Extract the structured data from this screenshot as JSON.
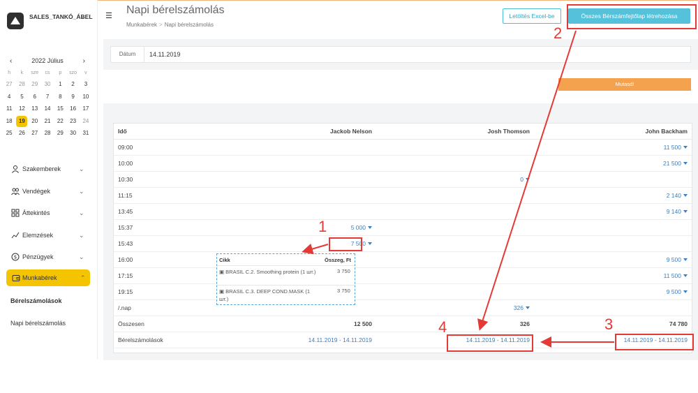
{
  "brand": {
    "name": "SALES_TANKÓ_ÁBEL"
  },
  "calendar": {
    "title": "2022 Július",
    "weekdays": [
      "h",
      "k",
      "sze",
      "cs",
      "p",
      "szo",
      "v"
    ],
    "weeks": [
      [
        "27",
        "28",
        "29",
        "30",
        "1",
        "2",
        "3"
      ],
      [
        "4",
        "5",
        "6",
        "7",
        "8",
        "9",
        "10"
      ],
      [
        "11",
        "12",
        "13",
        "14",
        "15",
        "16",
        "17"
      ],
      [
        "18",
        "19",
        "20",
        "21",
        "22",
        "23",
        "24"
      ],
      [
        "25",
        "26",
        "27",
        "28",
        "29",
        "30",
        "31"
      ]
    ],
    "today": "19"
  },
  "sidebar": {
    "items": [
      {
        "label": "Szakemberek",
        "icon": "person-icon"
      },
      {
        "label": "Vendégek",
        "icon": "users-icon"
      },
      {
        "label": "Áttekintés",
        "icon": "grid-icon"
      },
      {
        "label": "Elemzések",
        "icon": "chart-icon"
      },
      {
        "label": "Pénzügyek",
        "icon": "dollar-icon"
      }
    ],
    "active": {
      "label": "Munkabérek",
      "icon": "wallet-icon"
    },
    "subitems": [
      "Bérelszámolások",
      "Napi bérelszámolás"
    ]
  },
  "header": {
    "title": "Napi bérelszámolás",
    "breadcrumb": [
      "Munkabérek",
      "Napi bérelszámolás"
    ],
    "excel_label": "Letöltés Excel-be",
    "create_label": "Összes Bérszámfejtőlap létrehozása"
  },
  "filter": {
    "date_label": "Dátum",
    "date_value": "14.11.2019",
    "show_label": "Mutasd!"
  },
  "table": {
    "time_header": "Idő",
    "employees": [
      "Jackob Nelson",
      "Josh Thomson",
      "John Backham"
    ],
    "rows": [
      {
        "time": "09:00",
        "cells": [
          "",
          "",
          "11 500"
        ]
      },
      {
        "time": "10:00",
        "cells": [
          "",
          "",
          "21 500"
        ]
      },
      {
        "time": "10:30",
        "cells": [
          "",
          "0",
          ""
        ]
      },
      {
        "time": "11:15",
        "cells": [
          "",
          "",
          "2 140"
        ]
      },
      {
        "time": "13:45",
        "cells": [
          "",
          "",
          "9 140"
        ]
      },
      {
        "time": "15:37",
        "cells": [
          "5 000",
          "",
          ""
        ]
      },
      {
        "time": "15:43",
        "cells": [
          "7 500",
          "",
          ""
        ]
      },
      {
        "time": "16:00",
        "cells": [
          "",
          "",
          "9 500"
        ]
      },
      {
        "time": "17:15",
        "cells": [
          "",
          "",
          "11 500"
        ]
      },
      {
        "time": "19:15",
        "cells": [
          "",
          "",
          "9 500"
        ]
      },
      {
        "time": "/.nap",
        "cells": [
          "",
          "326",
          ""
        ]
      }
    ],
    "total_label": "Összesen",
    "totals": [
      "12 500",
      "326",
      "74 780"
    ],
    "payroll_label": "Bérelszámolások",
    "payroll_ranges": [
      "14.11.2019 - 14.11.2019",
      "14.11.2019 - 14.11.2019",
      "14.11.2019 - 14.11.2019"
    ]
  },
  "popup": {
    "col_item": "Cikk",
    "col_amount": "Összeg, Ft",
    "items": [
      {
        "name": "BRASIL C.2. Smoothing protein (1 шт.)",
        "amount": "3 750"
      },
      {
        "name": "BRASIL C.3. DEEP COND.MASK (1 шт.)",
        "amount": "3 750"
      }
    ]
  },
  "annotations": [
    "1",
    "2",
    "3",
    "4"
  ],
  "colors": {
    "accent": "#f5c400",
    "primary": "#55c1da",
    "show": "#f5a24e",
    "annotation": "#e53935",
    "link": "#3a7fc1"
  }
}
